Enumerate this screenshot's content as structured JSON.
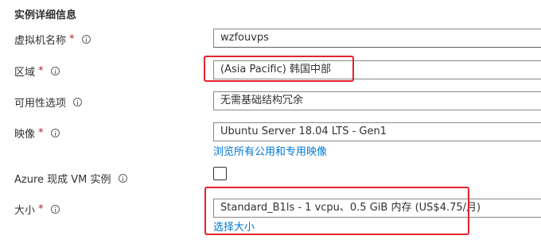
{
  "section": {
    "title": "实例详细信息"
  },
  "fields": {
    "vm_name": {
      "label": "虚拟机名称",
      "required_mark": "*",
      "value": "wzfouvps"
    },
    "region": {
      "label": "区域",
      "required_mark": "*",
      "value": "(Asia Pacific) 韩国中部"
    },
    "availability": {
      "label": "可用性选项",
      "value": "无需基础结构冗余"
    },
    "image": {
      "label": "映像",
      "required_mark": "*",
      "value": "Ubuntu Server 18.04 LTS - Gen1",
      "link": "浏览所有公用和专用映像"
    },
    "spot": {
      "label": "Azure 现成 VM 实例",
      "checked": false
    },
    "size": {
      "label": "大小",
      "required_mark": "*",
      "value": "Standard_B1ls - 1 vcpu、0.5 GiB 内存 (US$4.75/月)",
      "link": "选择大小"
    }
  },
  "colors": {
    "highlight": "#e3232c",
    "link": "#0078d4",
    "required": "#a4262c"
  },
  "icons": {
    "info": "info-icon"
  }
}
